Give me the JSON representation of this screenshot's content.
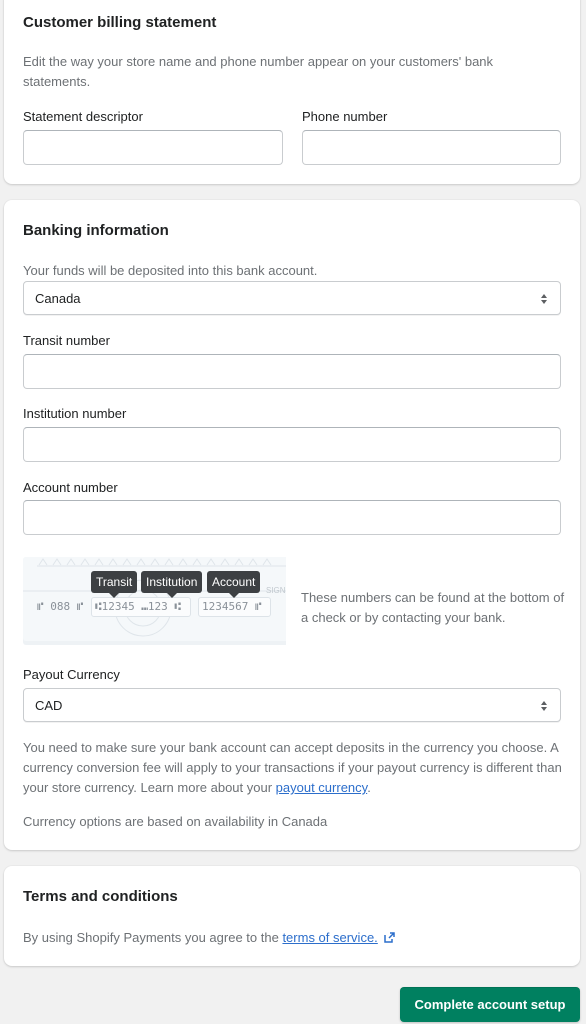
{
  "billing": {
    "title": "Customer billing statement",
    "description": "Edit the way your store name and phone number appear on your customers' bank statements.",
    "statement_descriptor_label": "Statement descriptor",
    "statement_descriptor_value": "",
    "phone_label": "Phone number",
    "phone_value": ""
  },
  "banking": {
    "title": "Banking information",
    "country_hint": "Your funds will be deposited into this bank account.",
    "country_value": "Canada",
    "transit_label": "Transit number",
    "transit_value": "",
    "institution_label": "Institution number",
    "institution_value": "",
    "account_label": "Account number",
    "account_value": "",
    "check": {
      "tip_transit": "Transit",
      "tip_institution": "Institution",
      "tip_account": "Account",
      "routing_prefix": "⑈ 088 ⑈",
      "transit_institution": "⑆12345 ⑉123 ⑆",
      "account": "1234567 ⑈"
    },
    "check_note": "These numbers can be found at the bottom of a check or by contacting your bank.",
    "payout_label": "Payout Currency",
    "payout_value": "CAD",
    "payout_note_text": "You need to make sure your bank account can accept deposits in the currency you choose. A currency conversion fee will apply to your transactions if your payout currency is different than your store currency. Learn more about your ",
    "payout_note_link": "payout currency",
    "payout_note_end": ".",
    "availability_note": "Currency options are based on availability in Canada"
  },
  "terms": {
    "title": "Terms and conditions",
    "text": "By using Shopify Payments you agree to the ",
    "link": "terms of service."
  },
  "actions": {
    "complete_label": "Complete account setup"
  },
  "colors": {
    "primary": "#008060",
    "link": "#2c6ecb",
    "tooltip": "#3d4043"
  }
}
